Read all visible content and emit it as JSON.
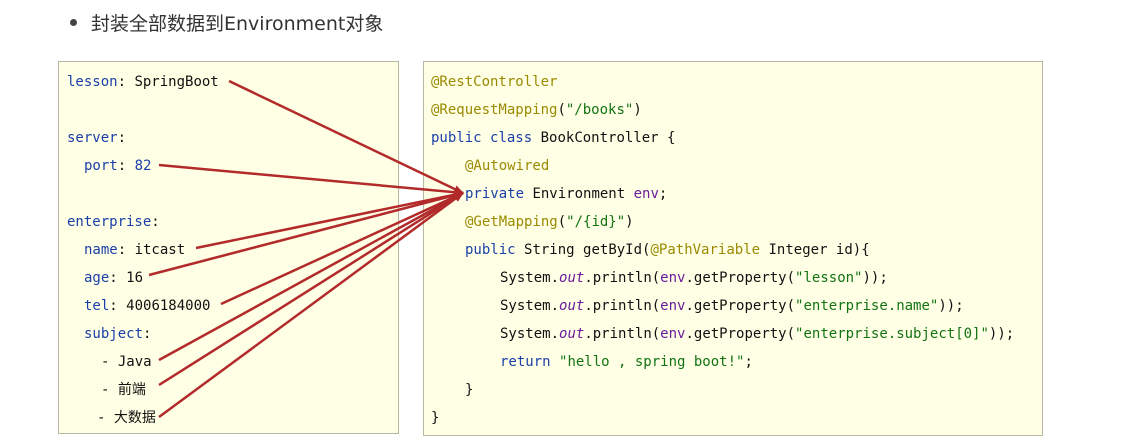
{
  "bullet": {
    "text": "封装全部数据到Environment对象"
  },
  "yaml": {
    "lesson_key": "lesson",
    "lesson_value": "SpringBoot",
    "server_key": "server",
    "port_key": "port",
    "port_value": "82",
    "enterprise_key": "enterprise",
    "name_key": "name",
    "name_value": "itcast",
    "age_key": "age",
    "age_value": "16",
    "tel_key": "tel",
    "tel_value": "4006184000",
    "subject_key": "subject",
    "subject_items": [
      "Java",
      "前端",
      "大数据"
    ]
  },
  "java": {
    "anno_rest": "@RestController",
    "anno_mapping": "@RequestMapping",
    "mapping_path": "\"/books\"",
    "kw_public": "public",
    "kw_class": "class",
    "class_name": "BookController {",
    "anno_autowired": "@Autowired",
    "kw_private": "private",
    "field_type": "Environment",
    "field_name": "env",
    "anno_getmapping": "@GetMapping",
    "get_path": "\"/{id}\"",
    "return_type": "String",
    "method_name": "getById",
    "anno_pathvar": "@PathVariable",
    "param": "Integer id){",
    "sys": "System.",
    "out": "out",
    "println": ".println(",
    "env_call": "env",
    "get_prop": ".getProperty(",
    "prop_lesson": "\"lesson\"",
    "prop_name": "\"enterprise.name\"",
    "prop_subject": "\"enterprise.subject[0]\"",
    "kw_return": "return",
    "return_value": "\"hello , spring boot!\"",
    "close_method": "}",
    "close_class": "}"
  },
  "colors": {
    "box_bg": "#ffffe6",
    "box_border": "#b8b8a0",
    "arrow": "#b22a2a",
    "keyword": "#1a3fa8",
    "annotation": "#9a8a00",
    "string": "#137313",
    "field": "#6a1b9a"
  }
}
